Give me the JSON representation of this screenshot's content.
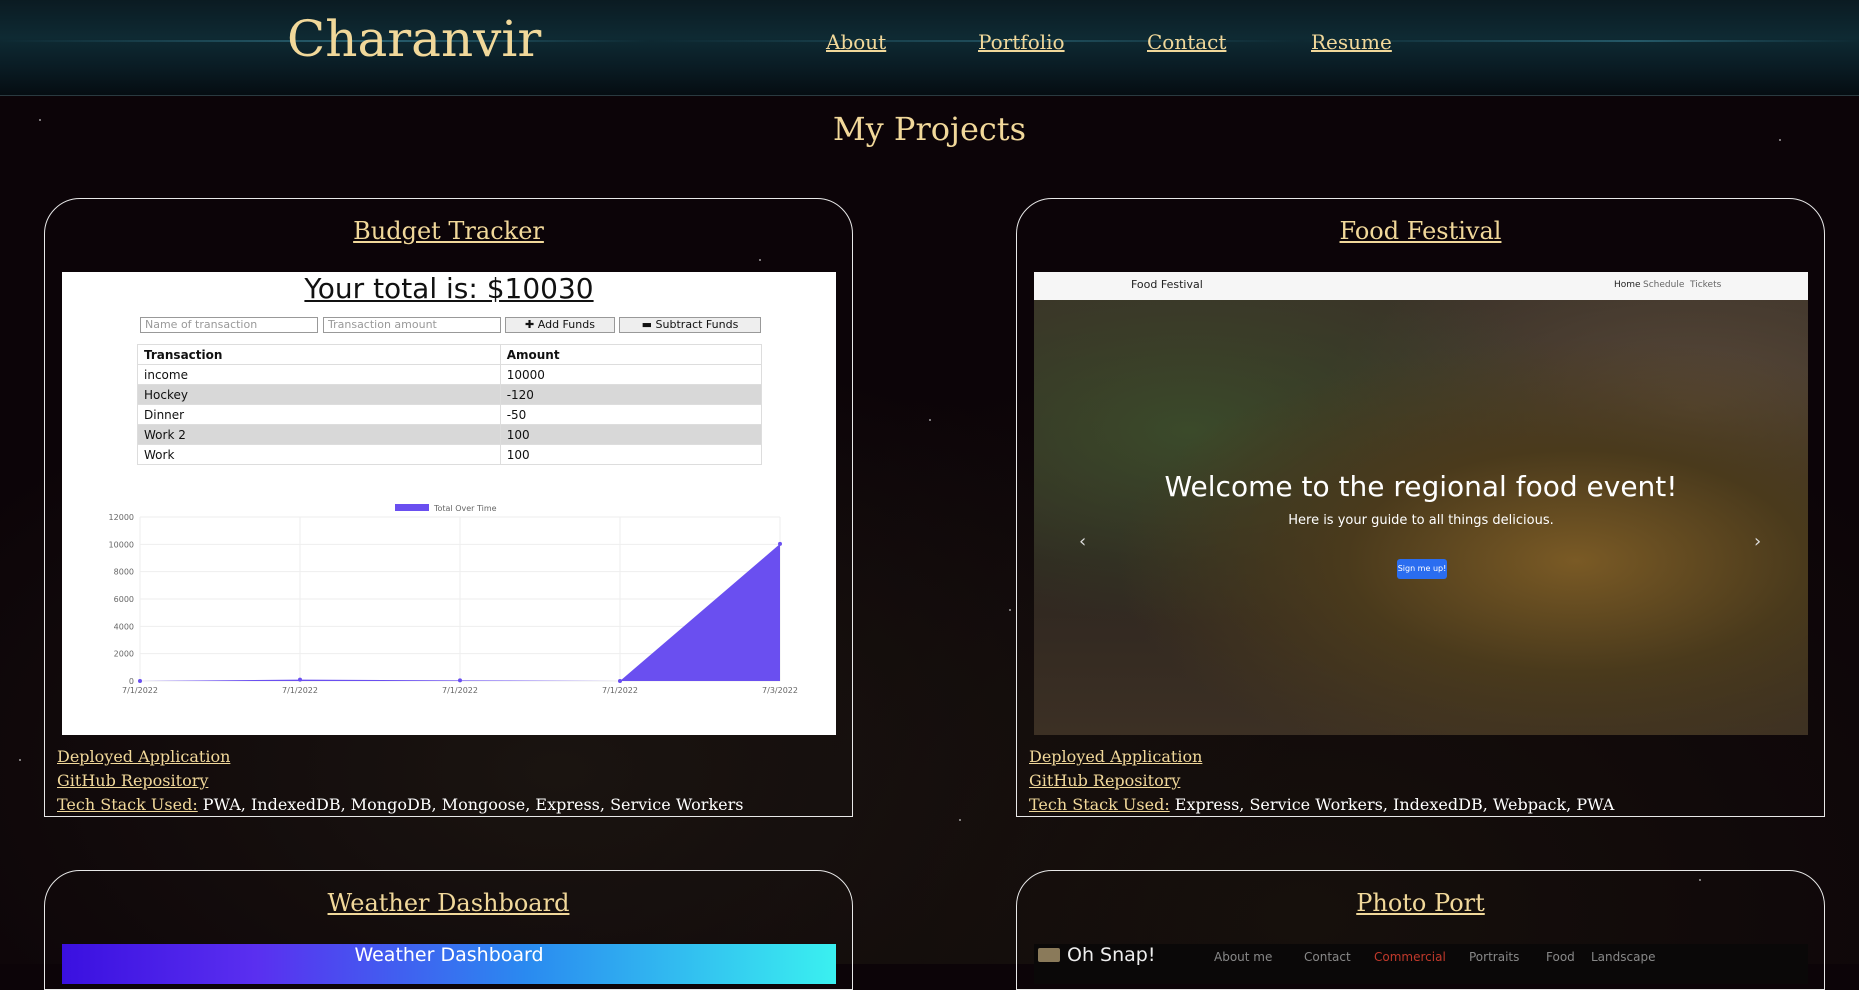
{
  "header": {
    "brand": "Charanvir",
    "nav": [
      "About",
      "Portfolio",
      "Contact",
      "Resume"
    ]
  },
  "page_title": "My Projects",
  "colors": {
    "accent": "#f1d89a",
    "background": "#0c0408"
  },
  "projects": [
    {
      "title": "Budget Tracker",
      "deployed": "Deployed Application",
      "repo": "GitHub Repository",
      "stack_label": "Tech Stack Used:",
      "stack": " PWA, IndexedDB, MongoDB, Mongoose, Express, Service Workers",
      "screenshot": {
        "total": "Your total is: $10030",
        "name_placeholder": "Name of transaction",
        "amount_placeholder": "Transaction amount",
        "add_btn": "✚ Add Funds",
        "subtract_btn": "▬ Subtract Funds",
        "headers": [
          "Transaction",
          "Amount"
        ],
        "rows": [
          [
            "income",
            "10000"
          ],
          [
            "Hockey",
            "-120"
          ],
          [
            "Dinner",
            "-50"
          ],
          [
            "Work 2",
            "100"
          ],
          [
            "Work",
            "100"
          ]
        ],
        "legend": "Total Over Time",
        "y_ticks": [
          "12000",
          "10000",
          "8000",
          "6000",
          "4000",
          "2000",
          "0"
        ],
        "x_ticks": [
          "7/1/2022",
          "7/1/2022",
          "7/1/2022",
          "7/1/2022",
          "7/3/2022"
        ],
        "values": [
          0,
          100,
          50,
          0,
          10030
        ]
      }
    },
    {
      "title": "Food Festival",
      "deployed": "Deployed Application",
      "repo": "GitHub Repository",
      "stack_label": "Tech Stack Used:",
      "stack": " Express, Service Workers, IndexedDB, Webpack, PWA",
      "screenshot": {
        "brand": "Food Festival",
        "nav": [
          "Home",
          "Schedule",
          "Tickets"
        ],
        "headline": "Welcome to the regional food event!",
        "subheadline": "Here is your guide to all things delicious.",
        "button": "Sign me up!",
        "prev": "‹",
        "next": "›"
      }
    },
    {
      "title": "Weather Dashboard",
      "screenshot": {
        "header": "Weather Dashboard"
      }
    },
    {
      "title": "Photo Port",
      "screenshot": {
        "brand": "Oh Snap!",
        "nav": [
          "About me",
          "Contact",
          "Commercial",
          "Portraits",
          "Food",
          "Landscape"
        ]
      }
    }
  ]
}
